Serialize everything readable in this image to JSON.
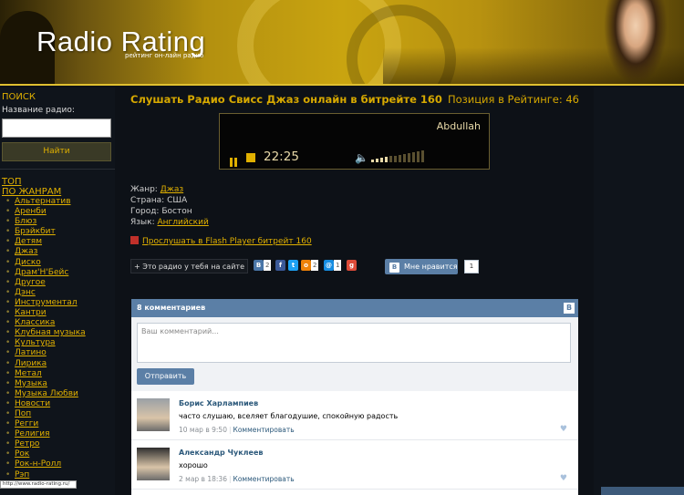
{
  "header": {
    "logo_title": "Radio Rating",
    "logo_subtitle": "рейтинг он-лайн радио"
  },
  "sidebar": {
    "search_heading": "ПОИСК",
    "search_label": "Название радио:",
    "search_value": "",
    "find_button": "Найти",
    "top_link": "ТОП",
    "by_genre_link": "ПО ЖАНРАМ",
    "genres": [
      "Альтернатив",
      "Аренби",
      "Блюз",
      "Брэйкбит",
      "Детям",
      "Джаз",
      "Диско",
      "Драм'Н'Бейс",
      "Другое",
      "Дэнс",
      "Инструментал",
      "Кантри",
      "Классика",
      "Клубная музыка",
      "Культура",
      "Латино",
      "Лирика",
      "Метал",
      "Музыка",
      "Музыка Любви",
      "Новости",
      "Поп",
      "Регги",
      "Религия",
      "Ретро",
      "Рок",
      "Рок-н-Ролл",
      "Рэп"
    ]
  },
  "status_tip": "http://www.radio-rating.ru/",
  "main": {
    "title": "Слушать Радио Свисс Джаз онлайн в битрейте 160",
    "rating_position": "Позиция в Рейтинге: 46",
    "player": {
      "station_text": "Abdullah",
      "time": "22:25",
      "volume_level": 0.3
    },
    "info": {
      "genre_label": "Жанр:",
      "genre_value": "Джаз",
      "country_label": "Страна:",
      "country_value": "США",
      "city_label": "Город:",
      "city_value": "Бостон",
      "language_label": "Язык:",
      "language_value": "Английский"
    },
    "flash_link": "Прослушать в Flash Player битрейт 160",
    "share": {
      "button": "Это радио у тебя на сайте",
      "vk_count": "2",
      "ok_count": "2",
      "mail_count": "1",
      "like_label": "Мне нравится",
      "like_count": "1"
    }
  },
  "comments": {
    "header": "8 комментариев",
    "placeholder": "Ваш комментарий...",
    "send_button": "Отправить",
    "items": [
      {
        "name": "Борис Харлампиев",
        "text": "часто слушаю, вселяет благодушие, спокойную радость",
        "date": "10 мар в 9:50",
        "reply": "Комментировать"
      },
      {
        "name": "Александр Чуклеев",
        "text": "хорошо",
        "date": "2 мар в 18:36",
        "reply": "Комментировать"
      }
    ]
  },
  "colors": {
    "accent_gold": "#e0b000",
    "vk_blue": "#5b7fa6",
    "background": "#0d1117"
  }
}
